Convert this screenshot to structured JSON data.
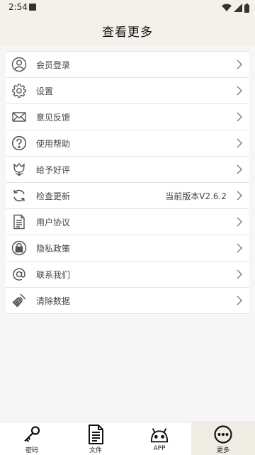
{
  "status_bar": {
    "time": "2:54"
  },
  "header": {
    "title": "查看更多"
  },
  "menu": {
    "items": [
      {
        "label": "会员登录",
        "icon": "user-icon"
      },
      {
        "label": "设置",
        "icon": "gear-icon"
      },
      {
        "label": "意见反馈",
        "icon": "mail-icon"
      },
      {
        "label": "使用帮助",
        "icon": "help-icon"
      },
      {
        "label": "给予好评",
        "icon": "tulip-icon"
      },
      {
        "label": "检查更新",
        "icon": "refresh-icon",
        "value": "当前版本V2.6.2"
      },
      {
        "label": "用户协议",
        "icon": "document-icon"
      },
      {
        "label": "隐私政策",
        "icon": "lock-icon"
      },
      {
        "label": "联系我们",
        "icon": "at-icon"
      },
      {
        "label": "清除数据",
        "icon": "broom-icon"
      }
    ]
  },
  "bottom_nav": {
    "items": [
      {
        "label": "密码",
        "icon": "key-icon"
      },
      {
        "label": "文件",
        "icon": "file-icon"
      },
      {
        "label": "APP",
        "icon": "android-icon"
      },
      {
        "label": "更多",
        "icon": "more-icon",
        "active": true
      }
    ]
  }
}
